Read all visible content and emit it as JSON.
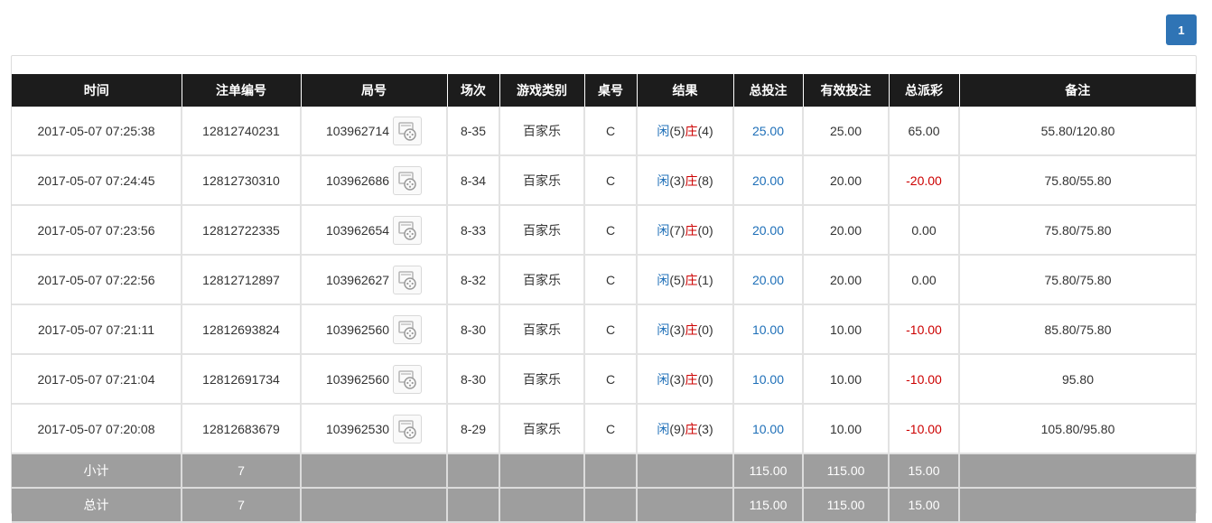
{
  "pagination": {
    "current": "1"
  },
  "columns": [
    "时间",
    "注单编号",
    "局号",
    "场次",
    "游戏类别",
    "桌号",
    "结果",
    "总投注",
    "有效投注",
    "总派彩",
    "备注"
  ],
  "rows": [
    {
      "time": "2017-05-07 07:25:38",
      "bet_id": "12812740231",
      "round_id": "103962714",
      "session": "8-35",
      "game": "百家乐",
      "table": "C",
      "player_label": "闲",
      "player_score": "(5)",
      "banker_label": "庄",
      "banker_score": "(4)",
      "total_bet": "25.00",
      "valid_bet": "25.00",
      "payout": "65.00",
      "payout_negative": false,
      "note": "55.80/120.80"
    },
    {
      "time": "2017-05-07 07:24:45",
      "bet_id": "12812730310",
      "round_id": "103962686",
      "session": "8-34",
      "game": "百家乐",
      "table": "C",
      "player_label": "闲",
      "player_score": "(3)",
      "banker_label": "庄",
      "banker_score": "(8)",
      "total_bet": "20.00",
      "valid_bet": "20.00",
      "payout": "-20.00",
      "payout_negative": true,
      "note": "75.80/55.80"
    },
    {
      "time": "2017-05-07 07:23:56",
      "bet_id": "12812722335",
      "round_id": "103962654",
      "session": "8-33",
      "game": "百家乐",
      "table": "C",
      "player_label": "闲",
      "player_score": "(7)",
      "banker_label": "庄",
      "banker_score": "(0)",
      "total_bet": "20.00",
      "valid_bet": "20.00",
      "payout": "0.00",
      "payout_negative": false,
      "note": "75.80/75.80"
    },
    {
      "time": "2017-05-07 07:22:56",
      "bet_id": "12812712897",
      "round_id": "103962627",
      "session": "8-32",
      "game": "百家乐",
      "table": "C",
      "player_label": "闲",
      "player_score": "(5)",
      "banker_label": "庄",
      "banker_score": "(1)",
      "total_bet": "20.00",
      "valid_bet": "20.00",
      "payout": "0.00",
      "payout_negative": false,
      "note": "75.80/75.80"
    },
    {
      "time": "2017-05-07 07:21:11",
      "bet_id": "12812693824",
      "round_id": "103962560",
      "session": "8-30",
      "game": "百家乐",
      "table": "C",
      "player_label": "闲",
      "player_score": "(3)",
      "banker_label": "庄",
      "banker_score": "(0)",
      "total_bet": "10.00",
      "valid_bet": "10.00",
      "payout": "-10.00",
      "payout_negative": true,
      "note": "85.80/75.80"
    },
    {
      "time": "2017-05-07 07:21:04",
      "bet_id": "12812691734",
      "round_id": "103962560",
      "session": "8-30",
      "game": "百家乐",
      "table": "C",
      "player_label": "闲",
      "player_score": "(3)",
      "banker_label": "庄",
      "banker_score": "(0)",
      "total_bet": "10.00",
      "valid_bet": "10.00",
      "payout": "-10.00",
      "payout_negative": true,
      "note": "95.80"
    },
    {
      "time": "2017-05-07 07:20:08",
      "bet_id": "12812683679",
      "round_id": "103962530",
      "session": "8-29",
      "game": "百家乐",
      "table": "C",
      "player_label": "闲",
      "player_score": "(9)",
      "banker_label": "庄",
      "banker_score": "(3)",
      "total_bet": "10.00",
      "valid_bet": "10.00",
      "payout": "-10.00",
      "payout_negative": true,
      "note": "105.80/95.80"
    }
  ],
  "subtotal": {
    "label": "小计",
    "count": "7",
    "total_bet": "115.00",
    "valid_bet": "115.00",
    "payout": "15.00"
  },
  "grandtotal": {
    "label": "总计",
    "count": "7",
    "total_bet": "115.00",
    "valid_bet": "115.00",
    "payout": "15.00"
  },
  "colors": {
    "pager": "#2f74b5",
    "header": "#1c1c1c",
    "footer": "#9e9e9e",
    "blue": "#1e6fb8",
    "red": "#cc0000"
  },
  "icons": {
    "video": "video-replay-icon"
  }
}
